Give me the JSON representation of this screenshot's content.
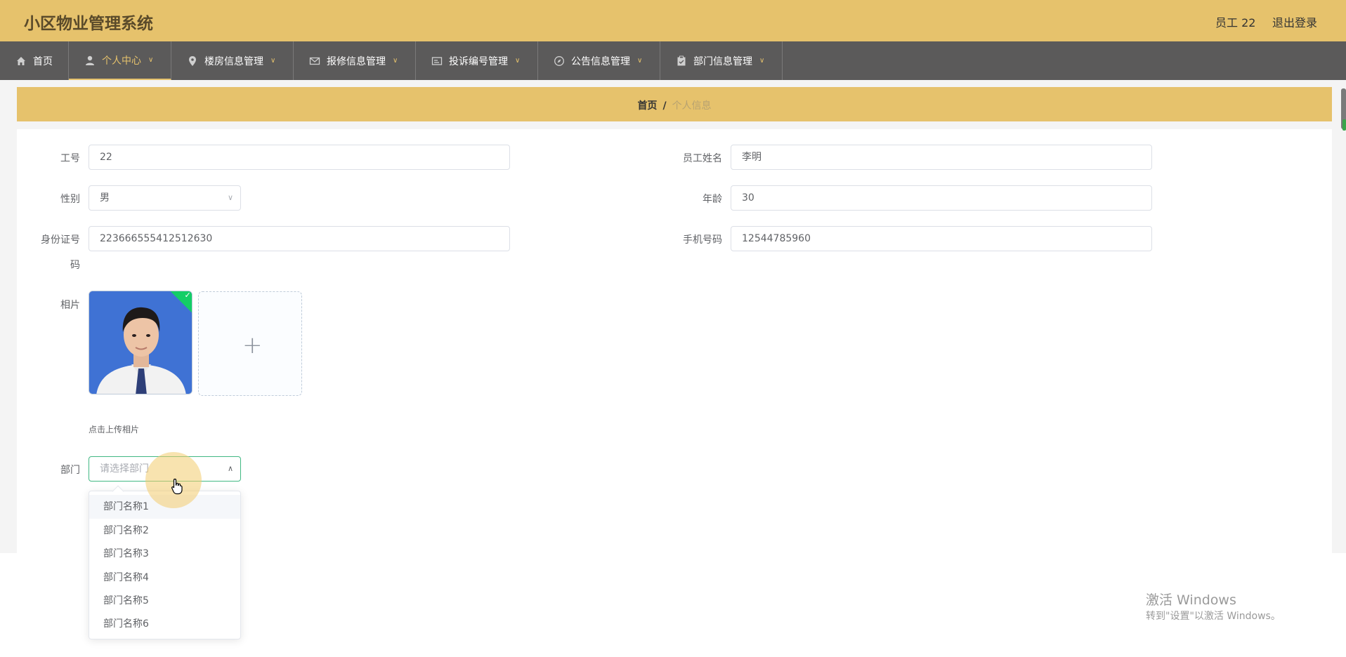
{
  "header": {
    "app_title": "小区物业管理系统",
    "user_label": "员工 22",
    "logout_label": "退出登录",
    "bg_color": "#e6c26c"
  },
  "nav": {
    "items": [
      {
        "label": "首页",
        "icon": "home-icon"
      },
      {
        "label": "个人中心",
        "icon": "user-icon",
        "active": true
      },
      {
        "label": "楼房信息管理",
        "icon": "location-icon"
      },
      {
        "label": "报修信息管理",
        "icon": "mail-icon"
      },
      {
        "label": "投诉编号管理",
        "icon": "card-icon"
      },
      {
        "label": "公告信息管理",
        "icon": "compass-icon"
      },
      {
        "label": "部门信息管理",
        "icon": "clipboard-icon"
      }
    ]
  },
  "breadcrumb": {
    "home": "首页",
    "separator": "/",
    "current": "个人信息"
  },
  "form": {
    "employee_no": {
      "label": "工号",
      "value": "22"
    },
    "employee_name": {
      "label": "员工姓名",
      "value": "李明"
    },
    "gender": {
      "label": "性别",
      "value": "男"
    },
    "age": {
      "label": "年龄",
      "value": "30"
    },
    "id_card": {
      "label_line1": "身份证号",
      "label_line2": "码",
      "value": "223666555412512630"
    },
    "phone": {
      "label": "手机号码",
      "value": "12544785960"
    },
    "photo": {
      "label": "相片",
      "upload_tip": "点击上传相片"
    },
    "department": {
      "label": "部门",
      "placeholder": "请选择部门",
      "options": [
        "部门名称1",
        "部门名称2",
        "部门名称3",
        "部门名称4",
        "部门名称5",
        "部门名称6"
      ]
    }
  },
  "watermark": {
    "line1": "激活 Windows",
    "line2": "转到\"设置\"以激活 Windows。"
  }
}
